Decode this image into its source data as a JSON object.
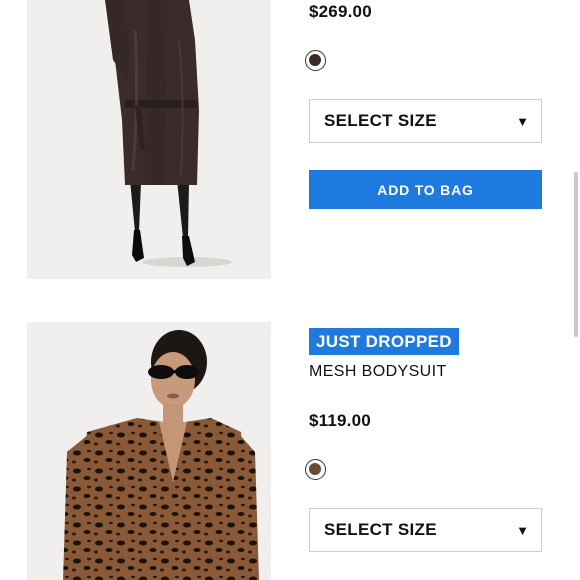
{
  "products": [
    {
      "price": "$269.00",
      "swatch_color": "#3a2a27",
      "size_select_label": "SELECT SIZE",
      "add_to_bag_label": "ADD TO BAG",
      "image_icon": "leather-trench-coat-photo"
    },
    {
      "badge": "JUST DROPPED",
      "name": "MESH BODYSUIT",
      "price": "$119.00",
      "swatch_color": "#6b4a33",
      "size_select_label": "SELECT SIZE",
      "image_icon": "leopard-mesh-bodysuit-photo"
    }
  ],
  "colors": {
    "accent": "#1f7ae0",
    "text": "#111111",
    "border": "#cfcfcf"
  },
  "icons": {
    "dropdown": "▼"
  }
}
